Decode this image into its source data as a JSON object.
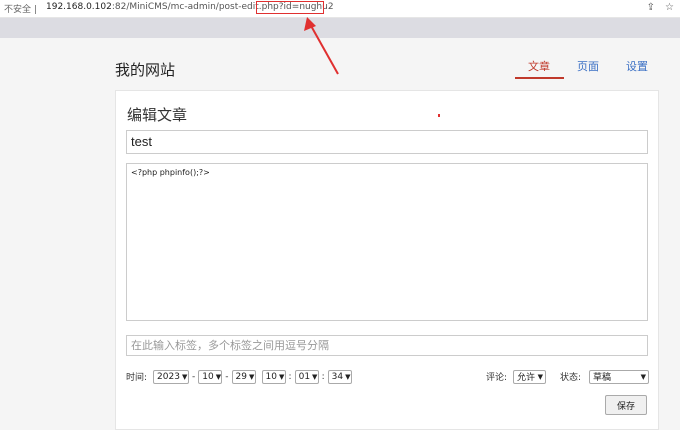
{
  "browser": {
    "insecure_label": "不安全",
    "url_host": "192.168.0.102",
    "url_rest": ":82/MiniCMS/mc-admin/post-edit.php",
    "url_query": "?id=nughu2",
    "share_icon": "share-icon",
    "star_icon": "star-icon",
    "annotation_color": "#e03030"
  },
  "site": {
    "title": "我的网站",
    "nav": {
      "article": "文章",
      "page": "页面",
      "settings": "设置"
    },
    "active_color": "#c0392b",
    "link_color": "#3a6fc4"
  },
  "editor": {
    "heading": "编辑文章",
    "title_value": "test",
    "content_value": "<?php phpinfo();?>",
    "tags_placeholder": "在此输入标签，多个标签之间用逗号分隔",
    "time_label": "时间:",
    "year": "2023",
    "month": "10",
    "day": "29",
    "hour": "10",
    "minute": "01",
    "second": "34",
    "date_sep": "-",
    "time_sep": ":",
    "comment_label": "评论:",
    "comment_value": "允许",
    "status_label": "状态:",
    "status_value": "草稿",
    "save_label": "保存"
  }
}
